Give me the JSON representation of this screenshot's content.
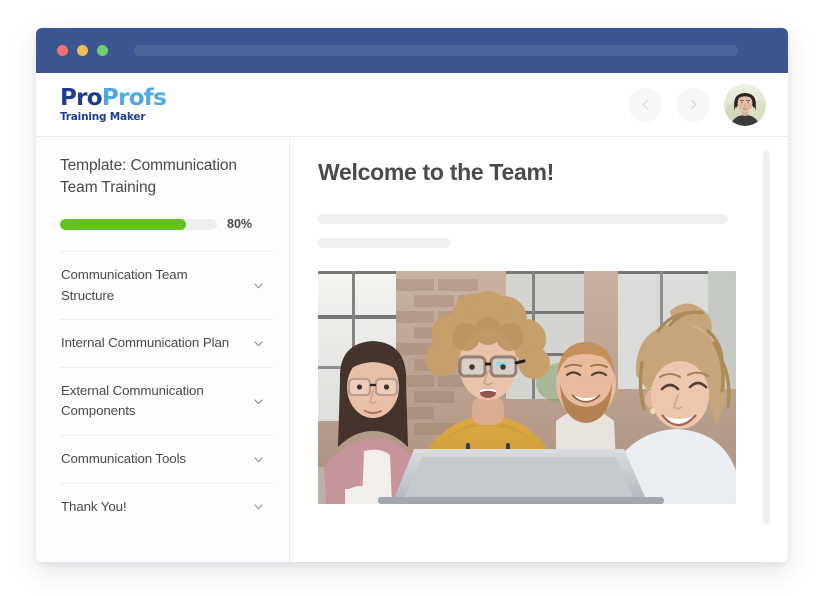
{
  "window": {
    "traffic_lights": [
      "close",
      "minimize",
      "maximize"
    ],
    "colors": {
      "titlebar": "#3b5691",
      "addressbar": "#4b659b",
      "dot_red": "#f2736e",
      "dot_yellow": "#f0bd52",
      "dot_green": "#6fcd74"
    }
  },
  "header": {
    "logo": {
      "word_one": "Pro",
      "word_two": "Profs",
      "tagline": "Training Maker",
      "color_dark": "#1c3f94",
      "color_light": "#4fa9e8"
    },
    "prev_label": "Previous",
    "next_label": "Next",
    "avatar_alt": "User profile photo"
  },
  "sidebar": {
    "template_title": "Template: Communication Team Training",
    "progress": {
      "percent_label": "80%",
      "value": 80,
      "fill_color": "#62c21f",
      "track_color": "#eeeeee"
    },
    "items": [
      {
        "label": "Communication Team Structure",
        "icon": "chevron-down"
      },
      {
        "label": "Internal Communication Plan",
        "icon": "chevron-down"
      },
      {
        "label": "External Communication Components",
        "icon": "chevron-down"
      },
      {
        "label": "Communication Tools",
        "icon": "chevron-down"
      },
      {
        "label": "Thank You!",
        "icon": "chevron-down"
      }
    ]
  },
  "main": {
    "title": "Welcome to the Team!",
    "placeholder_lines": 2,
    "hero_alt": "Four colleagues smiling while looking at a laptop together"
  }
}
